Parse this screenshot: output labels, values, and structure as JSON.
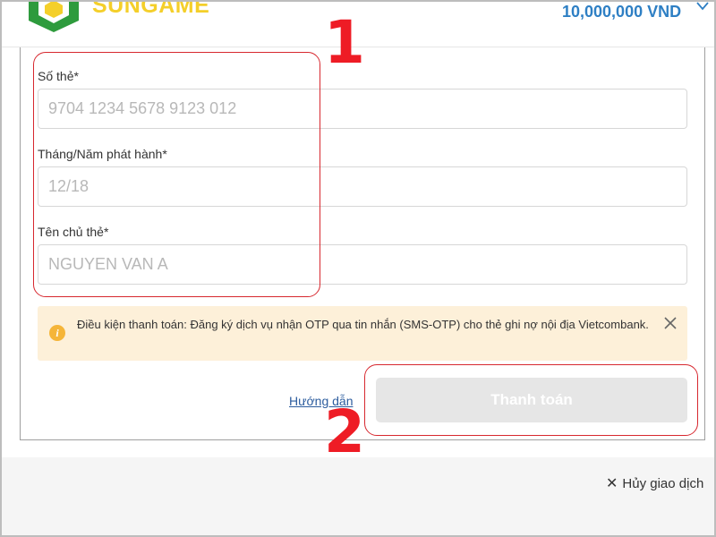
{
  "header": {
    "logo_text": "SUNGAME",
    "balance": "10,000,000 VND",
    "menu_icon": "chevron-down-icon"
  },
  "form": {
    "card_number": {
      "label": "Số thẻ*",
      "placeholder": "9704 1234 5678 9123 012",
      "value": ""
    },
    "issue_date": {
      "label": "Tháng/Năm phát hành*",
      "placeholder": "12/18",
      "value": ""
    },
    "holder_name": {
      "label": "Tên chủ thẻ*",
      "placeholder": "NGUYEN VAN A",
      "value": ""
    }
  },
  "notice": {
    "icon": "info-icon",
    "text": "Điều kiện thanh toán: Đăng ký dịch vụ nhận OTP qua tin nhắn (SMS-OTP) cho thẻ ghi nợ nội địa Vietcombank.",
    "close_icon": "close-icon"
  },
  "actions": {
    "guide_label": "Hướng dẫn",
    "pay_label": "Thanh toán"
  },
  "footer": {
    "cancel_icon": "close-icon",
    "cancel_label": "Hủy giao dịch"
  },
  "annotations": {
    "form_fields": "1",
    "pay_button": "2"
  },
  "colors": {
    "annotation_red": "#ee1c25",
    "balance_blue": "#2e7fc4",
    "logo_green": "#2e9b3d",
    "logo_yellow": "#f4cf2a",
    "notice_bg": "#fdf0d9",
    "notice_icon": "#f5b539",
    "button_disabled": "#e6e6e6"
  }
}
